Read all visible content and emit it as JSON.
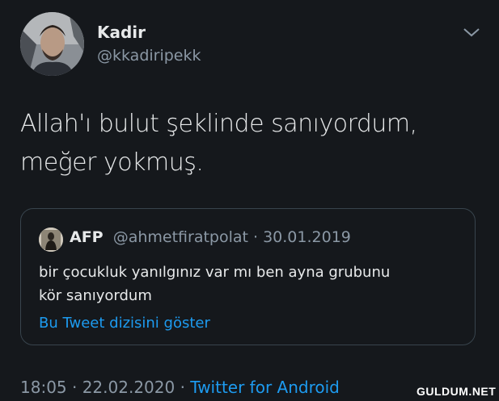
{
  "author": {
    "name": "Kadir",
    "handle": "@kkadiripekk"
  },
  "tweet": {
    "line1": "Allah'ı bulut şeklinde sanıyordum,",
    "line2": "meğer yokmuş."
  },
  "quoted": {
    "name": "AFP",
    "handle_date": "@ahmetfiratpolat · 30.01.2019",
    "line1": "bir çocukluk yanılgınız var mı ben ayna grubunu",
    "line2": "kör sanıyordum",
    "thread_link": "Bu Tweet dizisini göster"
  },
  "footer": {
    "time": "18:05 · 22.02.2020 · ",
    "source": "Twitter for Android"
  },
  "watermark": "GULDUM.NET",
  "icons": {
    "menu": "chevron-down-icon"
  },
  "colors": {
    "background": "#15181c",
    "link": "#1d9bf0",
    "secondary": "#8b98a5",
    "border": "#38444d"
  }
}
